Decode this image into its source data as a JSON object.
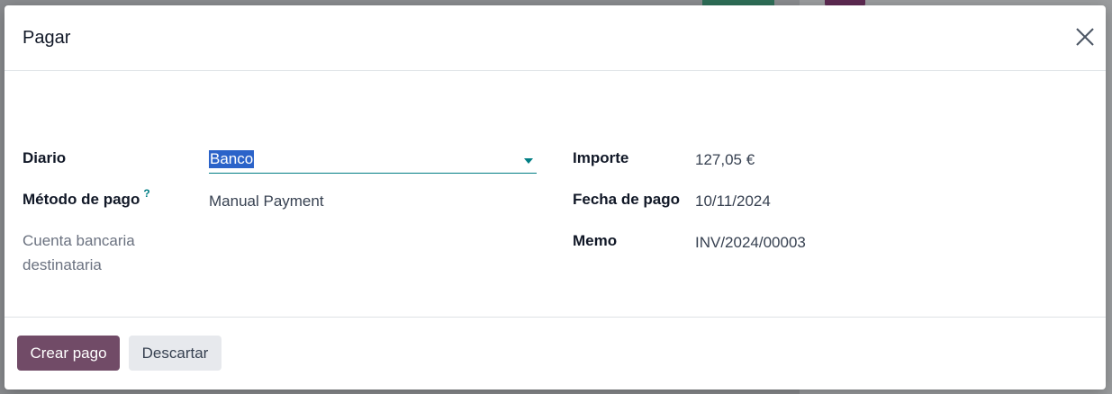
{
  "dialog": {
    "title": "Pagar",
    "close_icon": "close-icon"
  },
  "form": {
    "journal_label": "Diario",
    "journal_value": "Banco",
    "payment_method_label": "Método de pago",
    "payment_method_help": "?",
    "payment_method_value": "Manual Payment",
    "bank_account_label_line1": "Cuenta bancaria",
    "bank_account_label_line2": "destinataria",
    "amount_label": "Importe",
    "amount_value": "127,05 €",
    "date_label": "Fecha de pago",
    "date_value": "10/11/2024",
    "memo_label": "Memo",
    "memo_value": "INV/2024/00003"
  },
  "footer": {
    "create_label": "Crear pago",
    "discard_label": "Descartar"
  },
  "colors": {
    "primary": "#714b67",
    "accent": "#017e84",
    "selection": "#2b63c9"
  }
}
